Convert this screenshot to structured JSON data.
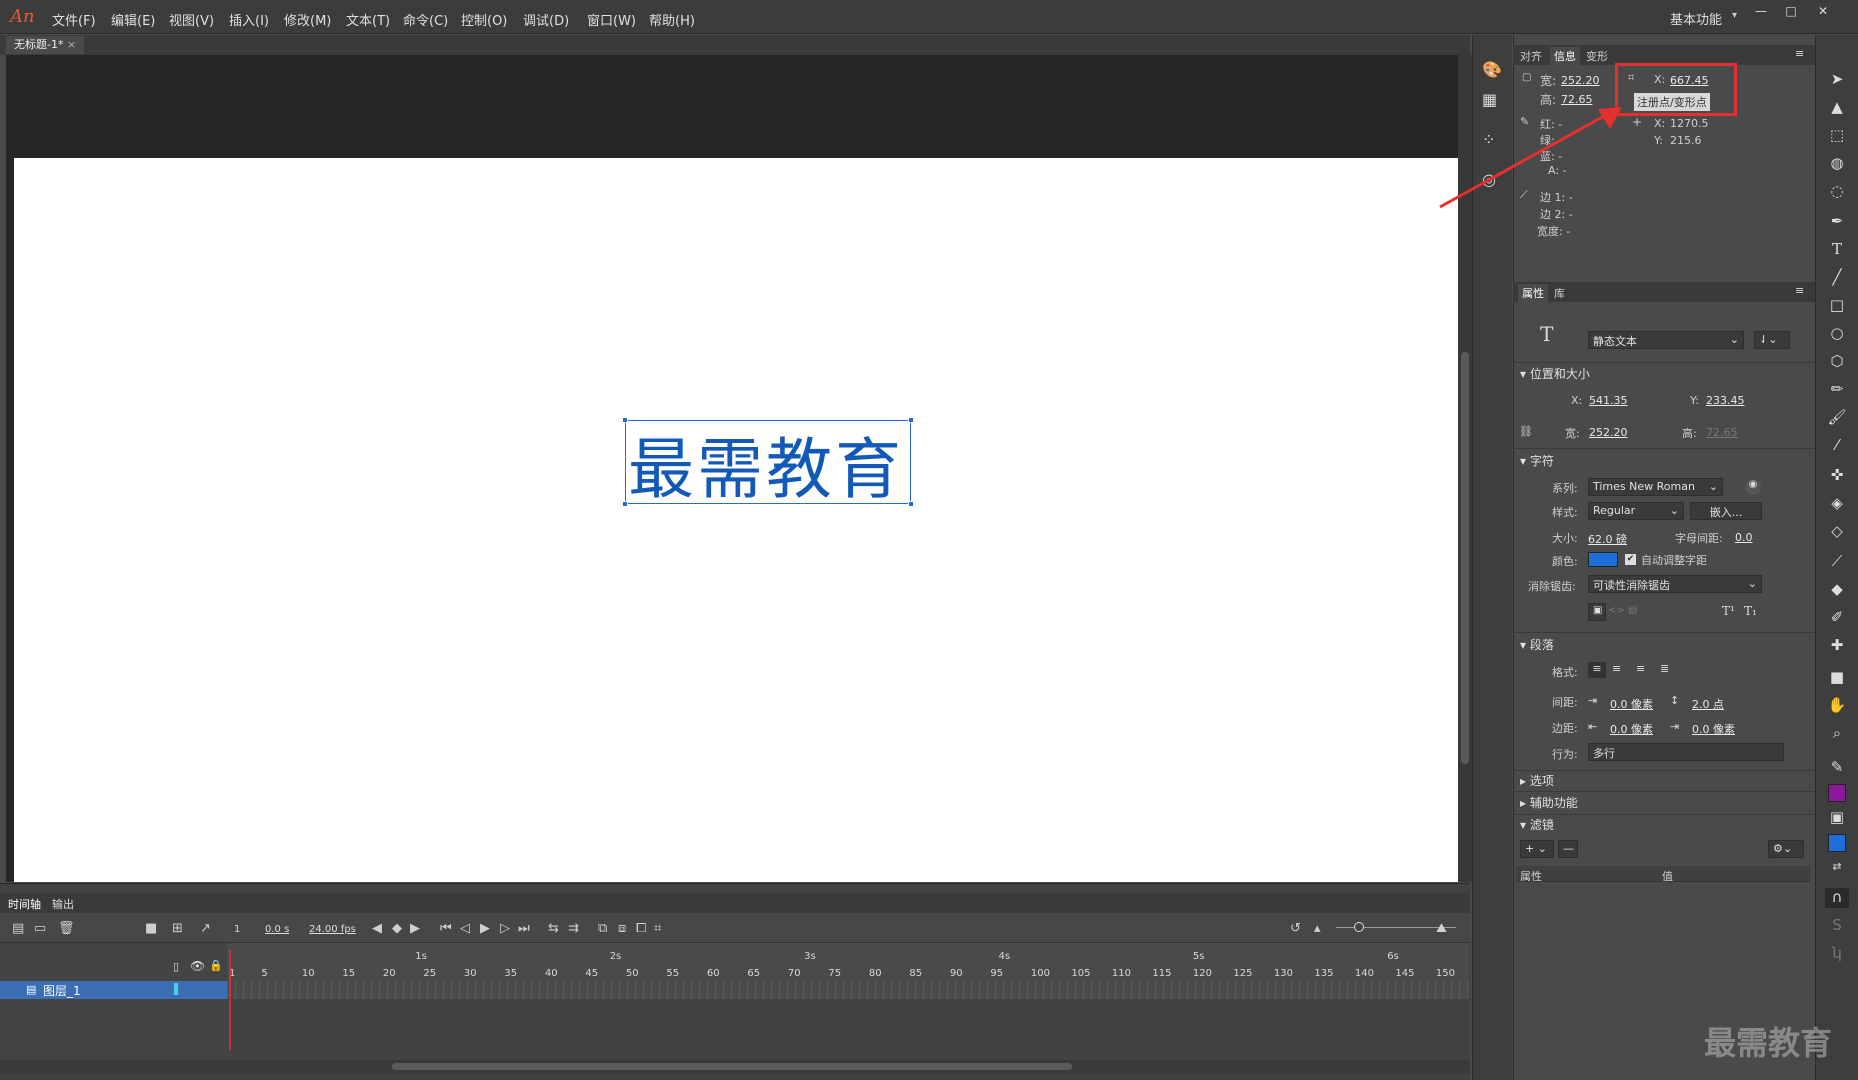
{
  "app": {
    "logo": "An"
  },
  "menu": [
    "文件(F)",
    "编辑(E)",
    "视图(V)",
    "插入(I)",
    "修改(M)",
    "文本(T)",
    "命令(C)",
    "控制(O)",
    "调试(D)",
    "窗口(W)",
    "帮助(H)"
  ],
  "workspace": "基本功能",
  "document": {
    "tab_title": "无标题-1*"
  },
  "stage": {
    "text": "最需教育",
    "text_color": "#1259b8"
  },
  "timeline": {
    "tabs": [
      "时间轴",
      "输出"
    ],
    "current_frame": "1",
    "time": "0.0 s",
    "fps": "24.00 fps",
    "seconds": [
      "1s",
      "2s",
      "3s",
      "4s",
      "5s",
      "6s"
    ],
    "frame_numbers": [
      "1",
      "5",
      "10",
      "15",
      "20",
      "25",
      "30",
      "35",
      "40",
      "45",
      "50",
      "55",
      "60",
      "65",
      "70",
      "75",
      "80",
      "85",
      "90",
      "95",
      "100",
      "105",
      "110",
      "115",
      "120",
      "125",
      "130",
      "135",
      "140",
      "145",
      "150"
    ],
    "layer_name": "图层_1"
  },
  "info_panel": {
    "tabs": [
      "对齐",
      "信息",
      "变形"
    ],
    "width_label": "宽:",
    "width": "252.20",
    "height_label": "高:",
    "height": "72.65",
    "reg_x_label": "X:",
    "reg_x": "667.45",
    "tooltip": "注册点/变形点",
    "red_label": "红: -",
    "green_label": "绿: -",
    "blue_label": "蓝: -",
    "alpha_label": "A: -",
    "cursor_x_label": "X:",
    "cursor_x": "1270.5",
    "cursor_y_label": "Y:",
    "cursor_y": "215.6",
    "edge1": "边 1: -",
    "edge2": "边 2: -",
    "stroke_w": "宽度: -"
  },
  "props_panel": {
    "tabs": [
      "属性",
      "库"
    ],
    "text_type": "静态文本",
    "pos_size_section": "位置和大小",
    "x_label": "X:",
    "x": "541.35",
    "y_label": "Y:",
    "y": "233.45",
    "w_label": "宽:",
    "w": "252.20",
    "h_label": "高:",
    "h": "72.65",
    "char_section": "字符",
    "family_label": "系列:",
    "family": "Times New Roman",
    "style_label": "样式:",
    "style": "Regular",
    "embed_button": "嵌入...",
    "size_label": "大小:",
    "size": "62.0 磅",
    "spacing_label": "字母间距:",
    "spacing": "0.0",
    "color_label": "颜色:",
    "text_color": "#1e6fd9",
    "auto_kern": "自动调整字距",
    "aa_label": "消除锯齿:",
    "aa": "可读性消除锯齿",
    "para_section": "段落",
    "format_label": "格式:",
    "spacing2_label": "间距:",
    "indent": "0.0 像素",
    "line_spacing": "2.0 点",
    "margin_label": "边距:",
    "margin_left": "0.0 像素",
    "margin_right": "0.0 像素",
    "behavior_label": "行为:",
    "behavior": "多行",
    "options_section": "选项",
    "access_section": "辅助功能",
    "filters_section": "滤镜",
    "filter_col_prop": "属性",
    "filter_col_val": "值"
  },
  "colors": {
    "stroke": "#8a1a9a",
    "fill": "#1e6fd9"
  },
  "watermark": "最需教育"
}
